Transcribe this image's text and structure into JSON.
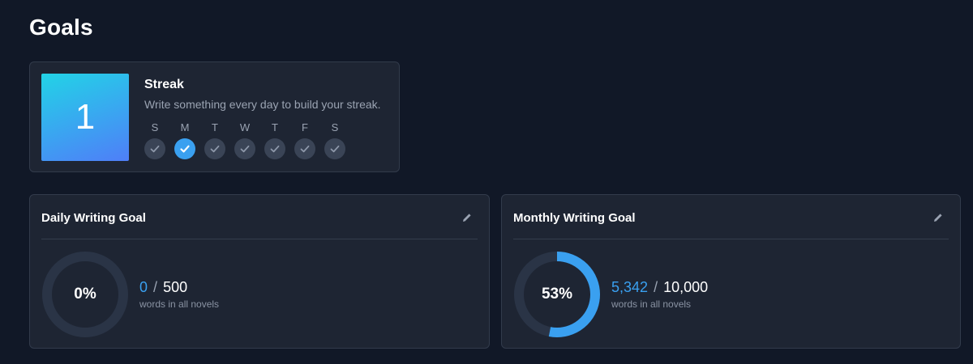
{
  "page": {
    "title": "Goals"
  },
  "streak": {
    "count": "1",
    "title": "Streak",
    "subtitle": "Write something every day to build your streak.",
    "days": [
      {
        "letter": "S",
        "done": false
      },
      {
        "letter": "M",
        "done": true
      },
      {
        "letter": "T",
        "done": false
      },
      {
        "letter": "W",
        "done": false
      },
      {
        "letter": "T",
        "done": false
      },
      {
        "letter": "F",
        "done": false
      },
      {
        "letter": "S",
        "done": false
      }
    ]
  },
  "daily_goal": {
    "title": "Daily Writing Goal",
    "percent_label": "0%",
    "progress": 0,
    "current": "0",
    "separator": "/",
    "target": "500",
    "caption": "words in all novels"
  },
  "monthly_goal": {
    "title": "Monthly Writing Goal",
    "percent_label": "53%",
    "progress": 0.53,
    "current": "5,342",
    "separator": "/",
    "target": "10,000",
    "caption": "words in all novels"
  },
  "colors": {
    "accent": "#3aa0f0",
    "ring_track": "#2a3446",
    "check_inactive": "#3a4456"
  }
}
